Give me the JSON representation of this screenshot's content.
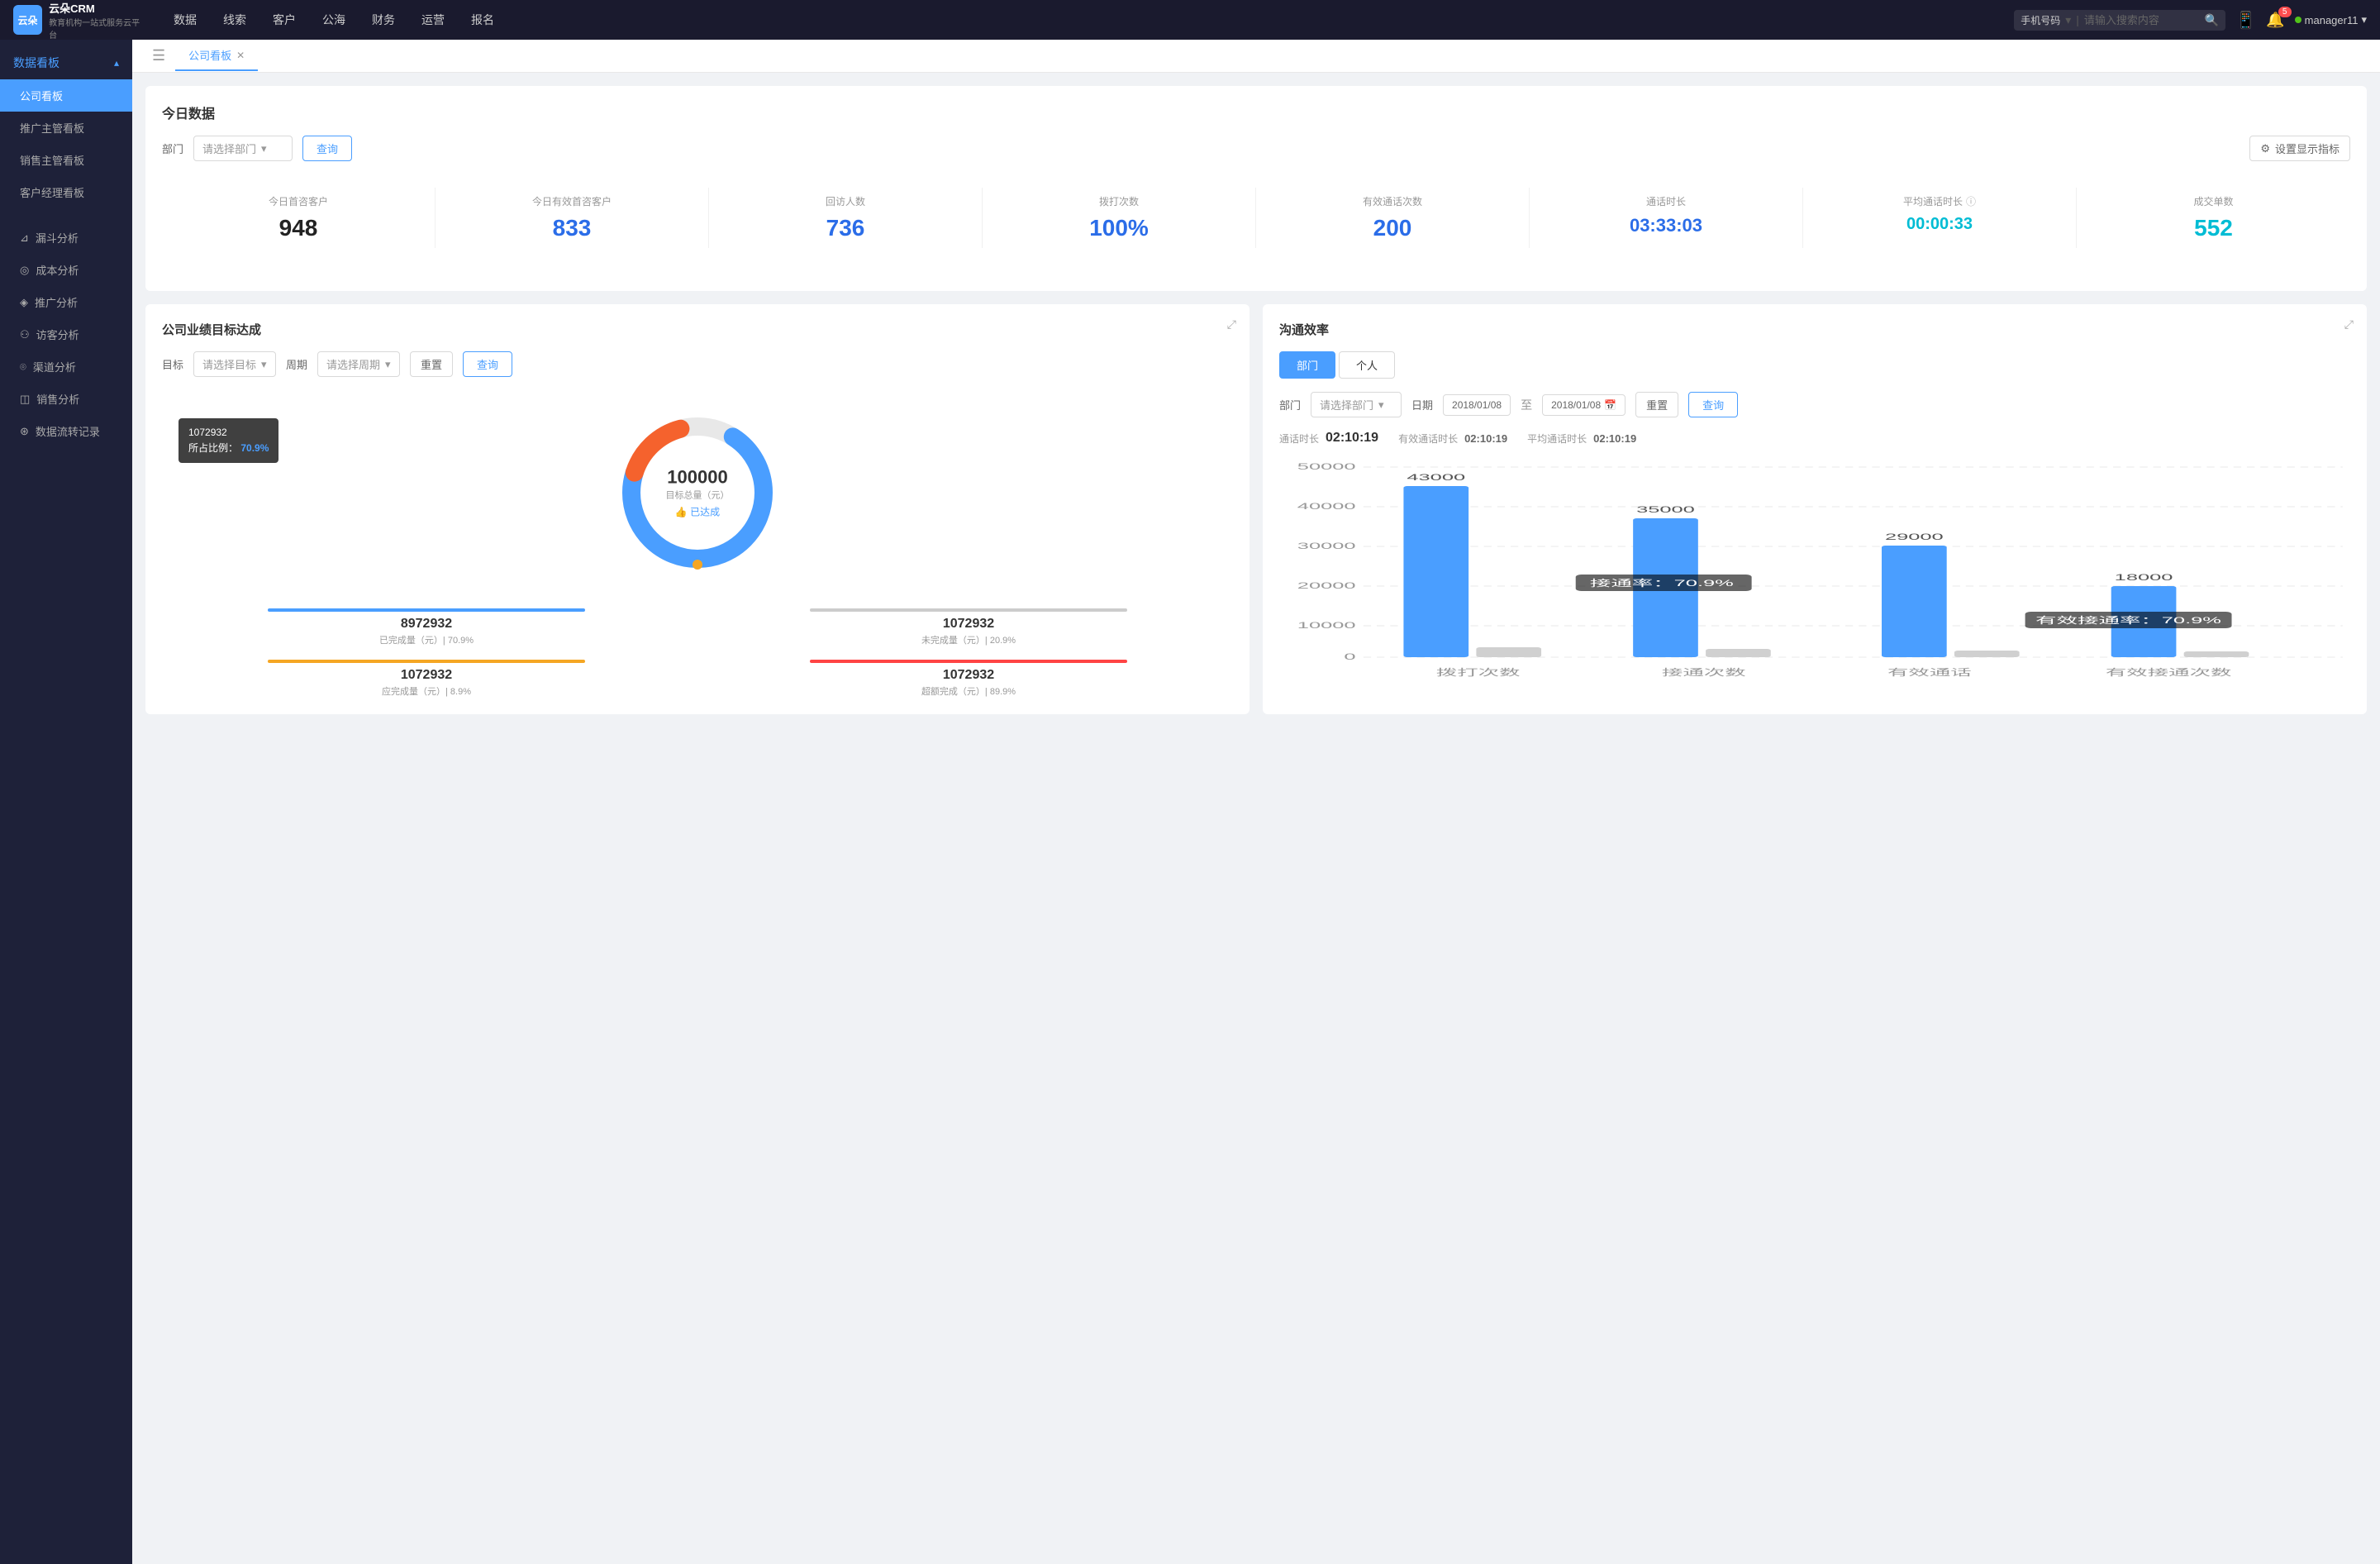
{
  "app": {
    "logo_text": "云朵CRM",
    "logo_sub": "教育机构一站式服务云平台"
  },
  "nav": {
    "items": [
      "数据",
      "线索",
      "客户",
      "公海",
      "财务",
      "运营",
      "报名"
    ],
    "search_placeholder": "请输入搜索内容",
    "search_select": "手机号码",
    "notification_badge": "5",
    "user": "manager11"
  },
  "sidebar": {
    "section_title": "数据看板",
    "items": [
      {
        "label": "公司看板",
        "active": true
      },
      {
        "label": "推广主管看板",
        "active": false
      },
      {
        "label": "销售主管看板",
        "active": false
      },
      {
        "label": "客户经理看板",
        "active": false
      }
    ],
    "menu": [
      {
        "label": "漏斗分析"
      },
      {
        "label": "成本分析"
      },
      {
        "label": "推广分析"
      },
      {
        "label": "访客分析"
      },
      {
        "label": "渠道分析"
      },
      {
        "label": "销售分析"
      },
      {
        "label": "数据流转记录"
      }
    ]
  },
  "tab": {
    "label": "公司看板"
  },
  "today_data": {
    "title": "今日数据",
    "filter_label": "部门",
    "filter_placeholder": "请选择部门",
    "query_btn": "查询",
    "settings_btn": "设置显示指标",
    "stats": [
      {
        "label": "今日首咨客户",
        "value": "948",
        "color": "dark"
      },
      {
        "label": "今日有效首咨客户",
        "value": "833",
        "color": "blue"
      },
      {
        "label": "回访人数",
        "value": "736",
        "color": "blue"
      },
      {
        "label": "拨打次数",
        "value": "100%",
        "color": "blue"
      },
      {
        "label": "有效通话次数",
        "value": "200",
        "color": "blue"
      },
      {
        "label": "通话时长",
        "value": "03:33:03",
        "color": "blue"
      },
      {
        "label": "平均通话时长",
        "value": "00:00:33",
        "color": "cyan",
        "has_info": true
      },
      {
        "label": "成交单数",
        "value": "552",
        "color": "cyan"
      }
    ]
  },
  "goal_panel": {
    "title": "公司业绩目标达成",
    "filter": {
      "goal_label": "目标",
      "goal_placeholder": "请选择目标",
      "period_label": "周期",
      "period_placeholder": "请选择周期",
      "reset_btn": "重置",
      "query_btn": "查询"
    },
    "donut": {
      "center_value": "100000",
      "center_label": "目标总量（元）",
      "center_sub": "👍 已达成"
    },
    "tooltip": {
      "id": "1072932",
      "ratio_label": "所占比例：",
      "ratio_value": "70.9%"
    },
    "stats": [
      {
        "value": "8972932",
        "label": "已完成量（元）| 70.9%",
        "color": "#4a9eff",
        "bar_color": "#4a9eff"
      },
      {
        "value": "1072932",
        "label": "未完成量（元）| 20.9%",
        "color": "#bbb",
        "bar_color": "#ccc"
      },
      {
        "value": "1072932",
        "label": "应完成量（元）| 8.9%",
        "color": "#f5a623",
        "bar_color": "#f5a623"
      },
      {
        "value": "1072932",
        "label": "超额完成（元）| 89.9%",
        "color": "#f44",
        "bar_color": "#f44"
      }
    ]
  },
  "comm_panel": {
    "title": "沟通效率",
    "tabs": [
      "部门",
      "个人"
    ],
    "active_tab": "部门",
    "filter": {
      "dept_label": "部门",
      "dept_placeholder": "请选择部门",
      "date_label": "日期",
      "date_from": "2018/01/08",
      "date_to": "2018/01/08",
      "reset_btn": "重置",
      "query_btn": "查询"
    },
    "stats": {
      "call_duration_label": "通话时长",
      "call_duration_value": "02:10:19",
      "effective_label": "有效通话时长",
      "effective_value": "02:10:19",
      "avg_label": "平均通话时长",
      "avg_value": "02:10:19"
    },
    "chart": {
      "y_labels": [
        "50000",
        "40000",
        "30000",
        "20000",
        "10000",
        "0"
      ],
      "groups": [
        {
          "x_label": "拨打次数",
          "bars": [
            {
              "value": 43000,
              "label": "43000",
              "color": "#4a9eff",
              "height_pct": 86
            },
            {
              "value": 0,
              "label": "",
              "color": "#d0d0d0",
              "height_pct": 10
            }
          ],
          "rate": null
        },
        {
          "x_label": "接通次数",
          "bars": [
            {
              "value": 35000,
              "label": "35000",
              "color": "#4a9eff",
              "height_pct": 70
            },
            {
              "value": 0,
              "label": "",
              "color": "#d0d0d0",
              "height_pct": 8
            }
          ],
          "rate": {
            "label": "接通率：70.9%",
            "offset_left": "25%"
          }
        },
        {
          "x_label": "有效通话",
          "bars": [
            {
              "value": 29000,
              "label": "29000",
              "color": "#4a9eff",
              "height_pct": 58
            },
            {
              "value": 0,
              "label": "",
              "color": "#d0d0d0",
              "height_pct": 6
            }
          ],
          "rate": null
        },
        {
          "x_label": "有效接通次数",
          "bars": [
            {
              "value": 18000,
              "label": "18000",
              "color": "#4a9eff",
              "height_pct": 36
            },
            {
              "value": 0,
              "label": "",
              "color": "#d0d0d0",
              "height_pct": 4
            }
          ],
          "rate": {
            "label": "有效接通率：70.9%",
            "offset_left": "72%"
          }
        }
      ]
    }
  }
}
